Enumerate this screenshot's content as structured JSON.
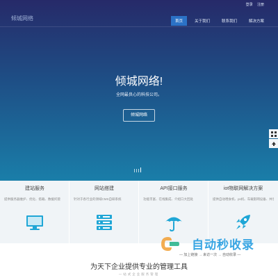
{
  "header": {
    "top_links": [
      "登录",
      "注册"
    ],
    "logo": "倾城网络",
    "nav": [
      "首页",
      "关于我们",
      "联系我们",
      "解决方案"
    ],
    "active_nav": 0
  },
  "hero": {
    "title": "倾城网络!",
    "subtitle": "全网最良心的科技公司。",
    "button": "倾城网络",
    "slide_count": 4,
    "active_slide": 3
  },
  "features": [
    {
      "title": "建站服务",
      "desc": "提供服务器维护、优化、搭载、数据托管",
      "icon": "monitor-icon"
    },
    {
      "title": "网站搭建",
      "desc": "针对于各行业的领域CMS自研系统",
      "icon": "server-icon"
    },
    {
      "title": "API接口服务",
      "desc": "功能丰富、在线集成、介绍口大回处",
      "icon": "umbrella-icon"
    },
    {
      "title": "iot物联网解决方案",
      "desc": "提供自动喂食机、ps机、车载影网设备、共享单车及充电宠解决方案",
      "icon": "rocket-icon"
    }
  ],
  "section": {
    "title": "为天下企业提供专业的管理工具",
    "subtitle": "一站式企业服务管理"
  },
  "watermark": {
    "text": "自动秒收录",
    "sub": "— 加上链接 → 来访一次 → 自动收录 —"
  },
  "colors": {
    "accent": "#2b72c6",
    "icon": "#1fa6d6",
    "feature_bg": "#f0f4f7"
  }
}
